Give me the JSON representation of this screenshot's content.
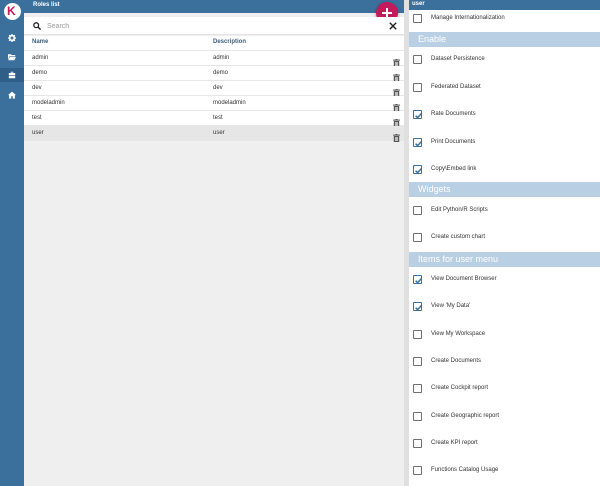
{
  "left": {
    "title": "Roles list",
    "search_placeholder": "Search",
    "columns": {
      "name": "Name",
      "description": "Description"
    },
    "rows": [
      {
        "name": "admin",
        "description": "admin",
        "selected": false
      },
      {
        "name": "demo",
        "description": "demo",
        "selected": false
      },
      {
        "name": "dev",
        "description": "dev",
        "selected": false
      },
      {
        "name": "modeladmin",
        "description": "modeladmin",
        "selected": false
      },
      {
        "name": "test",
        "description": "test",
        "selected": false
      },
      {
        "name": "user",
        "description": "user",
        "selected": true
      }
    ]
  },
  "right": {
    "title": "user",
    "top_option": {
      "label": "Manage Internationalization",
      "checked": false
    },
    "sections": [
      {
        "title": "Enable",
        "items": [
          {
            "label": "Dataset Persistence",
            "checked": false
          },
          {
            "label": "Federated Dataset",
            "checked": false
          },
          {
            "label": "Rate Documents",
            "checked": true
          },
          {
            "label": "Print Documents",
            "checked": true
          },
          {
            "label": "Copy\\Embed link",
            "checked": true
          }
        ]
      },
      {
        "title": "Widgets",
        "items": [
          {
            "label": "Edit Python/R Scripts",
            "checked": false
          },
          {
            "label": "Create custom chart",
            "checked": false
          }
        ]
      },
      {
        "title": "Items for user menu",
        "items": [
          {
            "label": "View Document Browser",
            "checked": true
          },
          {
            "label": "View 'My Data'",
            "checked": true
          },
          {
            "label": "View My Workspace",
            "checked": false
          },
          {
            "label": "Create Documents",
            "checked": false
          },
          {
            "label": "Create Cockpit report",
            "checked": false
          },
          {
            "label": "Create Geographic report",
            "checked": false
          },
          {
            "label": "Create KPI report",
            "checked": false
          },
          {
            "label": "Functions Catalog Usage",
            "checked": false
          }
        ]
      }
    ]
  },
  "icons": {
    "logo": "knowage-logo",
    "rail": [
      "gear-icon",
      "folder-open-icon",
      "briefcase-icon",
      "home-icon"
    ]
  },
  "colors": {
    "primary": "#3b6f9c",
    "accent": "#c21a5a",
    "section": "#b8cfe4"
  }
}
